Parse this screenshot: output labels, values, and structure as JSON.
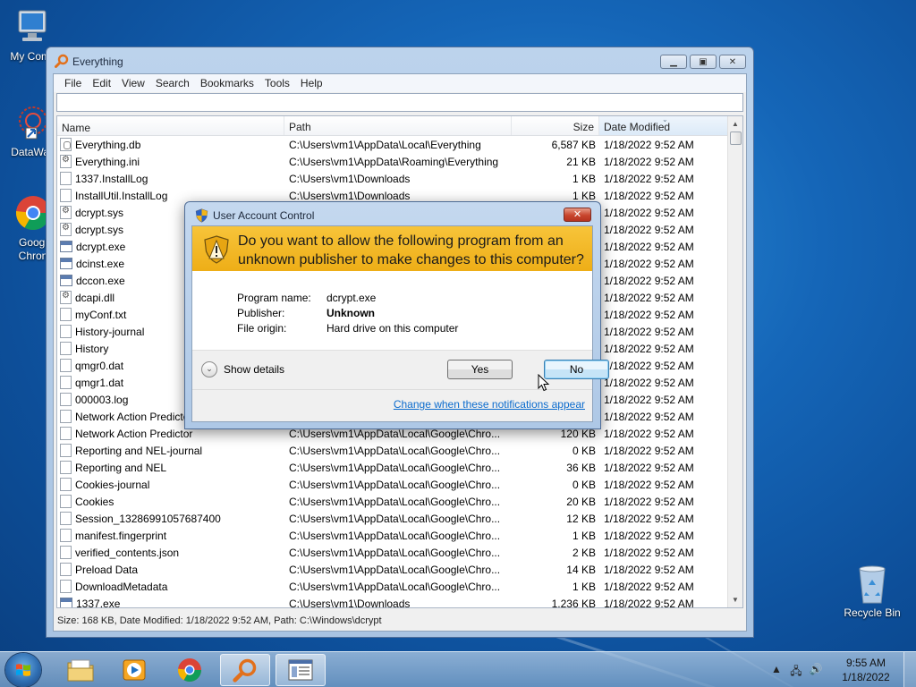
{
  "desktop": {
    "icons": [
      {
        "label": "My Comp"
      },
      {
        "label": "DataWag"
      },
      {
        "label": "Googl"
      },
      {
        "label": "Chron"
      },
      {
        "label": "Recycle Bin"
      }
    ]
  },
  "window": {
    "title": "Everything",
    "menu": [
      "File",
      "Edit",
      "View",
      "Search",
      "Bookmarks",
      "Tools",
      "Help"
    ],
    "search_value": "",
    "columns": {
      "name": "Name",
      "path": "Path",
      "size": "Size",
      "date": "Date Modified"
    },
    "rows": [
      {
        "name": "Everything.db",
        "path": "C:\\Users\\vm1\\AppData\\Local\\Everything",
        "size": "6,587 KB",
        "date": "1/18/2022 9:52 AM",
        "icon": "db"
      },
      {
        "name": "Everything.ini",
        "path": "C:\\Users\\vm1\\AppData\\Roaming\\Everything",
        "size": "21 KB",
        "date": "1/18/2022 9:52 AM",
        "icon": "cfg"
      },
      {
        "name": "1337.InstallLog",
        "path": "C:\\Users\\vm1\\Downloads",
        "size": "1 KB",
        "date": "1/18/2022 9:52 AM",
        "icon": "file"
      },
      {
        "name": "InstallUtil.InstallLog",
        "path": "C:\\Users\\vm1\\Downloads",
        "size": "1 KB",
        "date": "1/18/2022 9:52 AM",
        "icon": "file"
      },
      {
        "name": "dcrypt.sys",
        "path": "",
        "size": "",
        "date": "1/18/2022 9:52 AM",
        "icon": "cfg"
      },
      {
        "name": "dcrypt.sys",
        "path": "",
        "size": "",
        "date": "1/18/2022 9:52 AM",
        "icon": "cfg"
      },
      {
        "name": "dcrypt.exe",
        "path": "",
        "size": "",
        "date": "1/18/2022 9:52 AM",
        "icon": "exe"
      },
      {
        "name": "dcinst.exe",
        "path": "",
        "size": "",
        "date": "1/18/2022 9:52 AM",
        "icon": "exe"
      },
      {
        "name": "dccon.exe",
        "path": "",
        "size": "",
        "date": "1/18/2022 9:52 AM",
        "icon": "exe"
      },
      {
        "name": "dcapi.dll",
        "path": "",
        "size": "",
        "date": "1/18/2022 9:52 AM",
        "icon": "cfg"
      },
      {
        "name": "myConf.txt",
        "path": "",
        "size": "",
        "date": "1/18/2022 9:52 AM",
        "icon": "file"
      },
      {
        "name": "History-journal",
        "path": "",
        "size": "",
        "date": "1/18/2022 9:52 AM",
        "icon": "file"
      },
      {
        "name": "History",
        "path": "",
        "size": "",
        "date": "1/18/2022 9:52 AM",
        "icon": "file"
      },
      {
        "name": "qmgr0.dat",
        "path": "",
        "size": "",
        "date": "1/18/2022 9:52 AM",
        "icon": "file"
      },
      {
        "name": "qmgr1.dat",
        "path": "",
        "size": "",
        "date": "1/18/2022 9:52 AM",
        "icon": "file"
      },
      {
        "name": "000003.log",
        "path": "",
        "size": "",
        "date": "1/18/2022 9:52 AM",
        "icon": "file"
      },
      {
        "name": "Network Action Predicto",
        "path": "",
        "size": "",
        "date": "1/18/2022 9:52 AM",
        "icon": "file"
      },
      {
        "name": "Network Action Predictor",
        "path": "C:\\Users\\vm1\\AppData\\Local\\Google\\Chro...",
        "size": "120 KB",
        "date": "1/18/2022 9:52 AM",
        "icon": "file"
      },
      {
        "name": "Reporting and NEL-journal",
        "path": "C:\\Users\\vm1\\AppData\\Local\\Google\\Chro...",
        "size": "0 KB",
        "date": "1/18/2022 9:52 AM",
        "icon": "file"
      },
      {
        "name": "Reporting and NEL",
        "path": "C:\\Users\\vm1\\AppData\\Local\\Google\\Chro...",
        "size": "36 KB",
        "date": "1/18/2022 9:52 AM",
        "icon": "file"
      },
      {
        "name": "Cookies-journal",
        "path": "C:\\Users\\vm1\\AppData\\Local\\Google\\Chro...",
        "size": "0 KB",
        "date": "1/18/2022 9:52 AM",
        "icon": "file"
      },
      {
        "name": "Cookies",
        "path": "C:\\Users\\vm1\\AppData\\Local\\Google\\Chro...",
        "size": "20 KB",
        "date": "1/18/2022 9:52 AM",
        "icon": "file"
      },
      {
        "name": "Session_13286991057687400",
        "path": "C:\\Users\\vm1\\AppData\\Local\\Google\\Chro...",
        "size": "12 KB",
        "date": "1/18/2022 9:52 AM",
        "icon": "file"
      },
      {
        "name": "manifest.fingerprint",
        "path": "C:\\Users\\vm1\\AppData\\Local\\Google\\Chro...",
        "size": "1 KB",
        "date": "1/18/2022 9:52 AM",
        "icon": "file"
      },
      {
        "name": "verified_contents.json",
        "path": "C:\\Users\\vm1\\AppData\\Local\\Google\\Chro...",
        "size": "2 KB",
        "date": "1/18/2022 9:52 AM",
        "icon": "file"
      },
      {
        "name": "Preload Data",
        "path": "C:\\Users\\vm1\\AppData\\Local\\Google\\Chro...",
        "size": "14 KB",
        "date": "1/18/2022 9:52 AM",
        "icon": "file"
      },
      {
        "name": "DownloadMetadata",
        "path": "C:\\Users\\vm1\\AppData\\Local\\Google\\Chro...",
        "size": "1 KB",
        "date": "1/18/2022 9:52 AM",
        "icon": "file"
      },
      {
        "name": "1337.exe",
        "path": "C:\\Users\\vm1\\Downloads",
        "size": "1,236 KB",
        "date": "1/18/2022 9:52 AM",
        "icon": "exe"
      }
    ],
    "status": "Size: 168 KB, Date Modified: 1/18/2022 9:52 AM, Path: C:\\Windows\\dcrypt"
  },
  "uac": {
    "title": "User Account Control",
    "question_line1": "Do you want to allow the following program from an",
    "question_line2": "unknown publisher to make changes to this computer?",
    "program_label": "Program name:",
    "program_value": "dcrypt.exe",
    "publisher_label": "Publisher:",
    "publisher_value": "Unknown",
    "origin_label": "File origin:",
    "origin_value": "Hard drive on this computer",
    "show_details": "Show details",
    "yes": "Yes",
    "no": "No",
    "link": "Change when these notifications appear",
    "close": "✕"
  },
  "taskbar": {
    "time": "9:55 AM",
    "date": "1/18/2022"
  }
}
